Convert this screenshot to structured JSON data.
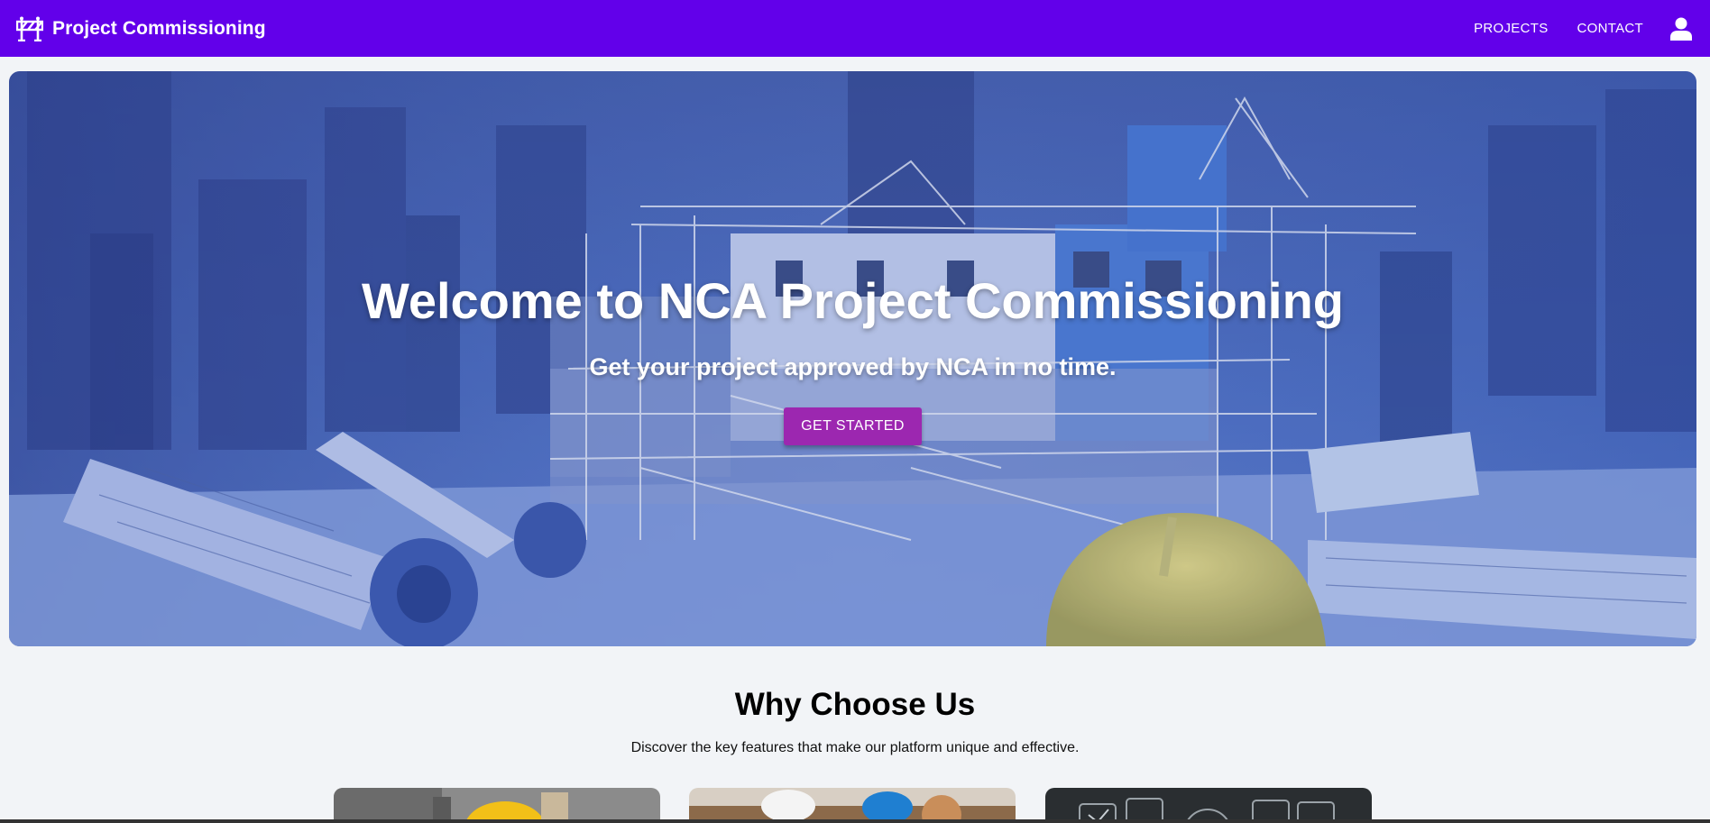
{
  "header": {
    "title": "Project Commissioning",
    "logo_icon": "road-barrier-icon",
    "nav": [
      {
        "label": "PROJECTS"
      },
      {
        "label": "CONTACT"
      }
    ],
    "account_icon": "user-icon",
    "color": "#6200ea"
  },
  "hero": {
    "title": "Welcome to NCA Project Commissioning",
    "subtitle": "Get your project approved by NCA in no time.",
    "cta_label": "GET STARTED",
    "cta_color": "#9c27b0",
    "background": "construction-site-blueprint-photo"
  },
  "features": {
    "title": "Why Choose Us",
    "subtitle": "Discover the key features that make our platform unique and effective.",
    "cards": [
      {
        "image": "worker-helmet-photo"
      },
      {
        "image": "engineers-team-photo"
      },
      {
        "image": "dashboard-icons-photo"
      }
    ]
  }
}
